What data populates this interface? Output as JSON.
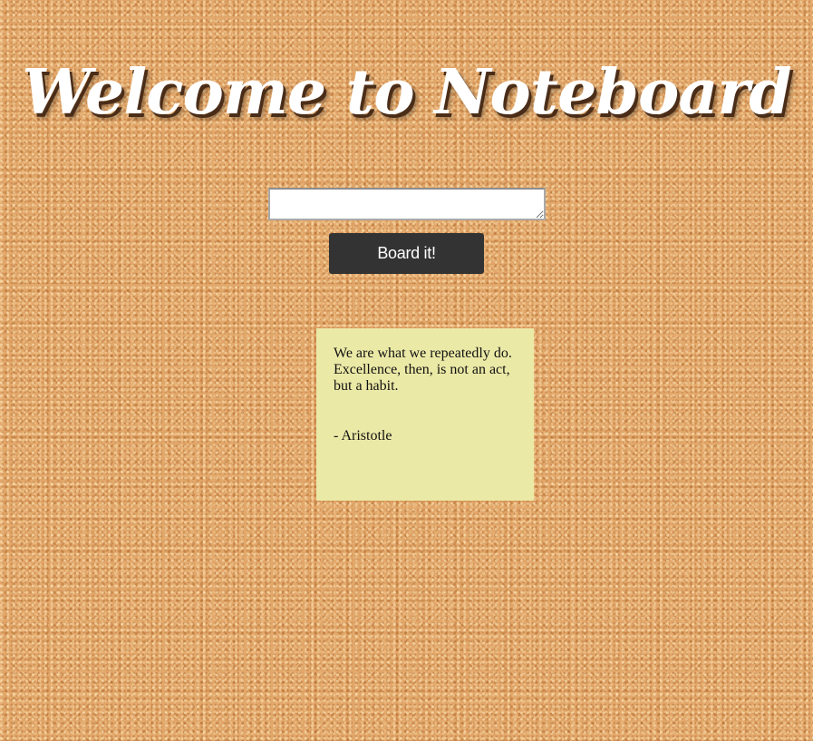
{
  "header": {
    "title": "Welcome to Noteboard"
  },
  "composer": {
    "input_value": "",
    "button_label": "Board it!"
  },
  "notes": [
    {
      "text": "We are what we repeatedly do.\nExcellence, then, is not an act, but a habit.",
      "author": "- Aristotle"
    }
  ],
  "colors": {
    "board": "#e2a76a",
    "note": "#ebe9a6",
    "button": "#333333",
    "title": "#ffffff"
  }
}
